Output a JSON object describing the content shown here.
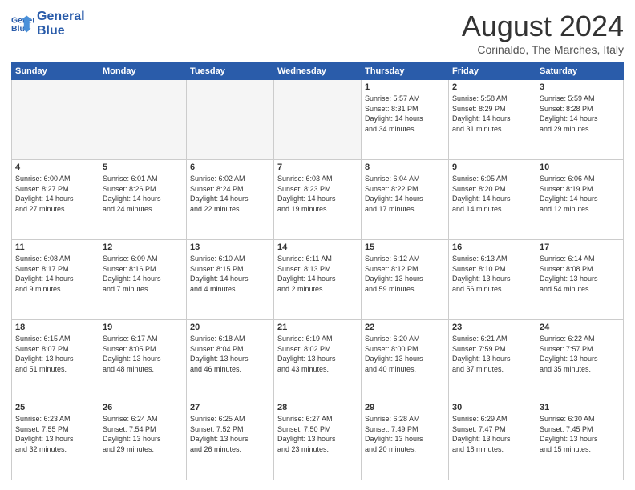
{
  "logo": {
    "line1": "General",
    "line2": "Blue"
  },
  "title": "August 2024",
  "subtitle": "Corinaldo, The Marches, Italy",
  "weekdays": [
    "Sunday",
    "Monday",
    "Tuesday",
    "Wednesday",
    "Thursday",
    "Friday",
    "Saturday"
  ],
  "weeks": [
    [
      {
        "day": "",
        "info": ""
      },
      {
        "day": "",
        "info": ""
      },
      {
        "day": "",
        "info": ""
      },
      {
        "day": "",
        "info": ""
      },
      {
        "day": "1",
        "info": "Sunrise: 5:57 AM\nSunset: 8:31 PM\nDaylight: 14 hours\nand 34 minutes."
      },
      {
        "day": "2",
        "info": "Sunrise: 5:58 AM\nSunset: 8:29 PM\nDaylight: 14 hours\nand 31 minutes."
      },
      {
        "day": "3",
        "info": "Sunrise: 5:59 AM\nSunset: 8:28 PM\nDaylight: 14 hours\nand 29 minutes."
      }
    ],
    [
      {
        "day": "4",
        "info": "Sunrise: 6:00 AM\nSunset: 8:27 PM\nDaylight: 14 hours\nand 27 minutes."
      },
      {
        "day": "5",
        "info": "Sunrise: 6:01 AM\nSunset: 8:26 PM\nDaylight: 14 hours\nand 24 minutes."
      },
      {
        "day": "6",
        "info": "Sunrise: 6:02 AM\nSunset: 8:24 PM\nDaylight: 14 hours\nand 22 minutes."
      },
      {
        "day": "7",
        "info": "Sunrise: 6:03 AM\nSunset: 8:23 PM\nDaylight: 14 hours\nand 19 minutes."
      },
      {
        "day": "8",
        "info": "Sunrise: 6:04 AM\nSunset: 8:22 PM\nDaylight: 14 hours\nand 17 minutes."
      },
      {
        "day": "9",
        "info": "Sunrise: 6:05 AM\nSunset: 8:20 PM\nDaylight: 14 hours\nand 14 minutes."
      },
      {
        "day": "10",
        "info": "Sunrise: 6:06 AM\nSunset: 8:19 PM\nDaylight: 14 hours\nand 12 minutes."
      }
    ],
    [
      {
        "day": "11",
        "info": "Sunrise: 6:08 AM\nSunset: 8:17 PM\nDaylight: 14 hours\nand 9 minutes."
      },
      {
        "day": "12",
        "info": "Sunrise: 6:09 AM\nSunset: 8:16 PM\nDaylight: 14 hours\nand 7 minutes."
      },
      {
        "day": "13",
        "info": "Sunrise: 6:10 AM\nSunset: 8:15 PM\nDaylight: 14 hours\nand 4 minutes."
      },
      {
        "day": "14",
        "info": "Sunrise: 6:11 AM\nSunset: 8:13 PM\nDaylight: 14 hours\nand 2 minutes."
      },
      {
        "day": "15",
        "info": "Sunrise: 6:12 AM\nSunset: 8:12 PM\nDaylight: 13 hours\nand 59 minutes."
      },
      {
        "day": "16",
        "info": "Sunrise: 6:13 AM\nSunset: 8:10 PM\nDaylight: 13 hours\nand 56 minutes."
      },
      {
        "day": "17",
        "info": "Sunrise: 6:14 AM\nSunset: 8:08 PM\nDaylight: 13 hours\nand 54 minutes."
      }
    ],
    [
      {
        "day": "18",
        "info": "Sunrise: 6:15 AM\nSunset: 8:07 PM\nDaylight: 13 hours\nand 51 minutes."
      },
      {
        "day": "19",
        "info": "Sunrise: 6:17 AM\nSunset: 8:05 PM\nDaylight: 13 hours\nand 48 minutes."
      },
      {
        "day": "20",
        "info": "Sunrise: 6:18 AM\nSunset: 8:04 PM\nDaylight: 13 hours\nand 46 minutes."
      },
      {
        "day": "21",
        "info": "Sunrise: 6:19 AM\nSunset: 8:02 PM\nDaylight: 13 hours\nand 43 minutes."
      },
      {
        "day": "22",
        "info": "Sunrise: 6:20 AM\nSunset: 8:00 PM\nDaylight: 13 hours\nand 40 minutes."
      },
      {
        "day": "23",
        "info": "Sunrise: 6:21 AM\nSunset: 7:59 PM\nDaylight: 13 hours\nand 37 minutes."
      },
      {
        "day": "24",
        "info": "Sunrise: 6:22 AM\nSunset: 7:57 PM\nDaylight: 13 hours\nand 35 minutes."
      }
    ],
    [
      {
        "day": "25",
        "info": "Sunrise: 6:23 AM\nSunset: 7:55 PM\nDaylight: 13 hours\nand 32 minutes."
      },
      {
        "day": "26",
        "info": "Sunrise: 6:24 AM\nSunset: 7:54 PM\nDaylight: 13 hours\nand 29 minutes."
      },
      {
        "day": "27",
        "info": "Sunrise: 6:25 AM\nSunset: 7:52 PM\nDaylight: 13 hours\nand 26 minutes."
      },
      {
        "day": "28",
        "info": "Sunrise: 6:27 AM\nSunset: 7:50 PM\nDaylight: 13 hours\nand 23 minutes."
      },
      {
        "day": "29",
        "info": "Sunrise: 6:28 AM\nSunset: 7:49 PM\nDaylight: 13 hours\nand 20 minutes."
      },
      {
        "day": "30",
        "info": "Sunrise: 6:29 AM\nSunset: 7:47 PM\nDaylight: 13 hours\nand 18 minutes."
      },
      {
        "day": "31",
        "info": "Sunrise: 6:30 AM\nSunset: 7:45 PM\nDaylight: 13 hours\nand 15 minutes."
      }
    ]
  ]
}
